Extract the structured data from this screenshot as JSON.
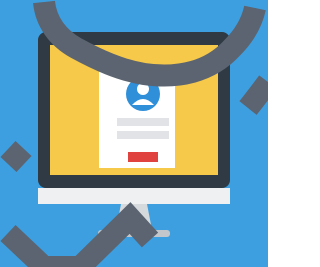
{
  "colors": {
    "background": "#3d9fe0",
    "monitor_bezel": "#2f3a45",
    "monitor_bezel_edge": "#27313b",
    "screen": "#f7c94a",
    "card": "#ffffff",
    "card_input": "#e1e3e6",
    "card_button": "#e0433f",
    "avatar_ring": "#2f8fd8",
    "avatar_face": "#ffffff",
    "chin": "#eef0f2",
    "stand": "#d7dadd",
    "stand_base": "#c3c7cb",
    "stroke": "#5b6470"
  },
  "icons": {
    "avatar": "user-avatar-icon",
    "monitor": "desktop-monitor-icon"
  }
}
